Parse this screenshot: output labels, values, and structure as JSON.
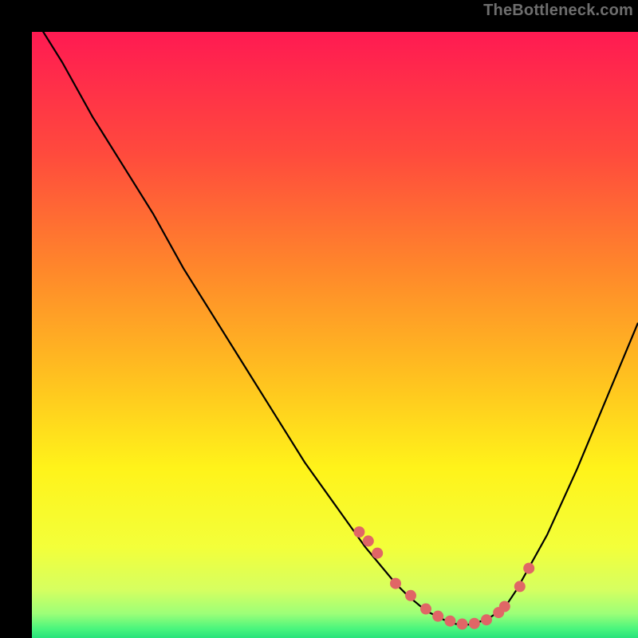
{
  "watermark": "TheBottleneck.com",
  "chart_data": {
    "type": "line",
    "title": "",
    "xlabel": "",
    "ylabel": "",
    "xlim": [
      0,
      100
    ],
    "ylim": [
      0,
      100
    ],
    "curve": {
      "x": [
        0,
        5,
        10,
        15,
        20,
        25,
        30,
        35,
        40,
        45,
        50,
        55,
        60,
        62,
        65,
        68,
        70,
        72,
        75,
        78,
        80,
        85,
        90,
        95,
        100
      ],
      "y": [
        103,
        95,
        86,
        78,
        70,
        61,
        53,
        45,
        37,
        29,
        22,
        15,
        9,
        7,
        4.5,
        3,
        2.3,
        2.2,
        3,
        5,
        8,
        17,
        28,
        40,
        52
      ]
    },
    "scatter_points": {
      "x": [
        54,
        55.5,
        57,
        60,
        62.5,
        65,
        67,
        69,
        71,
        73,
        75,
        77,
        78,
        80.5,
        82
      ],
      "y": [
        17.5,
        16,
        14,
        9,
        7,
        4.8,
        3.6,
        2.8,
        2.3,
        2.4,
        3.0,
        4.2,
        5.2,
        8.5,
        11.5
      ]
    },
    "gradient_stops": [
      {
        "offset": 0.0,
        "color": "#ff1a52"
      },
      {
        "offset": 0.2,
        "color": "#ff4a3d"
      },
      {
        "offset": 0.4,
        "color": "#ff8a2a"
      },
      {
        "offset": 0.58,
        "color": "#ffc41f"
      },
      {
        "offset": 0.72,
        "color": "#fff31a"
      },
      {
        "offset": 0.85,
        "color": "#f3ff3a"
      },
      {
        "offset": 0.92,
        "color": "#d6ff60"
      },
      {
        "offset": 0.96,
        "color": "#9cff78"
      },
      {
        "offset": 0.985,
        "color": "#49f57d"
      },
      {
        "offset": 1.0,
        "color": "#28e27b"
      }
    ],
    "curve_color": "#000000",
    "point_color": "#e06666",
    "point_radius": 7
  }
}
